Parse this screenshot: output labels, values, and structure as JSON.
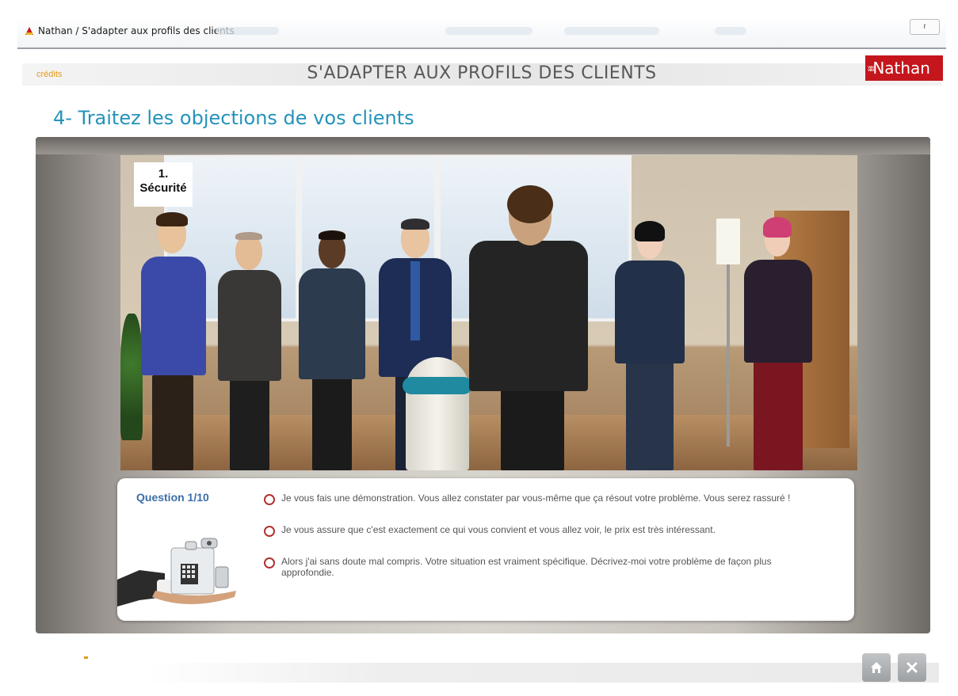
{
  "window": {
    "title": "Nathan / S'adapter aux profils des clients",
    "control_label": "ꭇ"
  },
  "header": {
    "credits_label": "crédits",
    "app_title": "S'ADAPTER AUX PROFILS DES CLIENTS",
    "brand": "Nathan"
  },
  "section": {
    "title": "4- Traitez les objections de vos clients"
  },
  "scene": {
    "tag_number": "1.",
    "tag_label": "Sécurité"
  },
  "question": {
    "counter": "Question 1/10",
    "answers": [
      "Je vous fais une démonstration. Vous allez constater par vous-même que ça résout votre problème. Vous serez rassuré !",
      "Je vous assure que c'est exactement ce qui vous convient et vous allez voir, le prix est très intéressant.",
      "Alors j'ai sans doute mal compris. Votre situation est vraiment spécifique. Décrivez-moi votre problème de façon plus approfondie."
    ]
  },
  "nav": {
    "home_icon": "home-icon",
    "close_icon": "close-icon"
  },
  "colors": {
    "accent_blue": "#2593b9",
    "brand_red": "#c4161c",
    "credits_orange": "#e69a1f",
    "radio_red": "#b23131",
    "question_blue": "#3b6ea8"
  }
}
